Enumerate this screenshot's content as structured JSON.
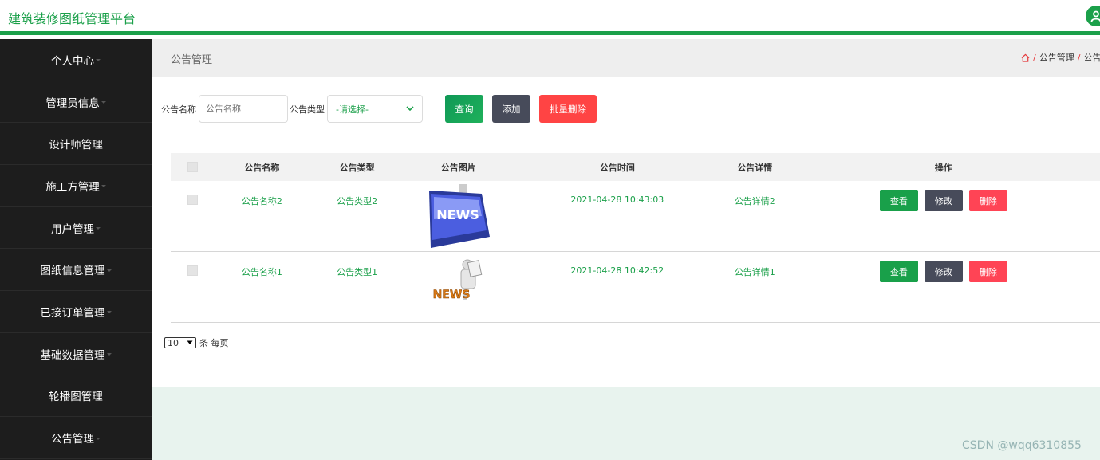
{
  "app": {
    "title": "建筑装修图纸管理平台"
  },
  "sidebar": {
    "items": [
      {
        "label": "个人中心",
        "caret": true
      },
      {
        "label": "管理员信息",
        "caret": true
      },
      {
        "label": "设计师管理",
        "caret": false
      },
      {
        "label": "施工方管理",
        "caret": true
      },
      {
        "label": "用户管理",
        "caret": true
      },
      {
        "label": "图纸信息管理",
        "caret": true
      },
      {
        "label": "已接订单管理",
        "caret": true
      },
      {
        "label": "基础数据管理",
        "caret": true
      },
      {
        "label": "轮播图管理",
        "caret": false
      },
      {
        "label": "公告管理",
        "caret": true
      }
    ]
  },
  "page": {
    "title": "公告管理",
    "breadcrumb": [
      "公告管理",
      "公告资"
    ]
  },
  "search": {
    "name_label": "公告名称",
    "name_placeholder": "公告名称",
    "type_label": "公告类型",
    "type_selected": "-请选择-",
    "query_button": "查询",
    "add_button": "添加",
    "batch_delete_button": "批量删除"
  },
  "table": {
    "headers": [
      "公告名称",
      "公告类型",
      "公告图片",
      "公告时间",
      "公告详情",
      "操作"
    ],
    "rows": [
      {
        "name": "公告名称2",
        "type": "公告类型2",
        "image": "news-keyboard-key",
        "image_text": "NEWS",
        "time": "2021-04-28 10:43:03",
        "detail": "公告详情2"
      },
      {
        "name": "公告名称1",
        "type": "公告类型1",
        "image": "news-reading-figure",
        "image_text": "NEWS",
        "time": "2021-04-28 10:42:52",
        "detail": "公告详情1"
      }
    ],
    "actions": {
      "view": "查看",
      "edit": "修改",
      "delete": "删除"
    }
  },
  "pager": {
    "page_size": "10",
    "suffix": "条 每页"
  },
  "watermark": "CSDN @wqq6310855",
  "colors": {
    "accent": "#1ba04a",
    "sidebar": "#1d1d1d",
    "danger": "#ff4444",
    "dark_button": "#474b5a"
  }
}
